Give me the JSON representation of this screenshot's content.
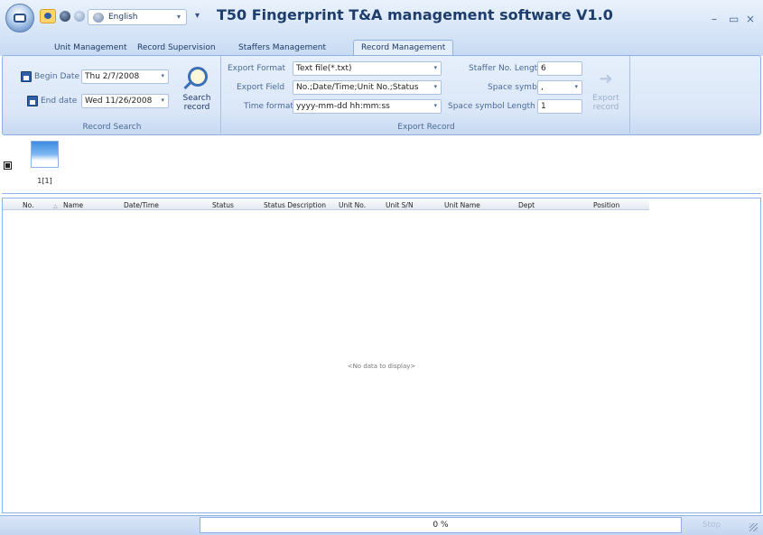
{
  "title_bar": {
    "language": "English",
    "app_title": "T50 Fingerprint T&A management software V1.0",
    "minimize": "–",
    "maximize": "▭",
    "close": "×"
  },
  "tabs": [
    "Unit Management",
    "Record Supervision",
    "Staffers Management",
    "Record Management"
  ],
  "active_tab": "Record Management",
  "record_search": {
    "begin_label": "Begin Date",
    "begin_value": "Thu 2/7/2008",
    "end_label": "End date",
    "end_value": "Wed 11/26/2008",
    "search_button": "Search record",
    "group_label": "Record Search"
  },
  "export_record": {
    "format_label": "Export Format",
    "format_value": "Text file(*.txt)",
    "field_label": "Export Field",
    "field_value": "No.;Date/Time;Unit No.;Status",
    "time_label": "Time format",
    "time_value": "yyyy-mm-dd hh:mm:ss",
    "staffer_len_label": "Staffer No. Length",
    "staffer_len_value": "6",
    "space_symbol_label": "Space symbol",
    "space_symbol_value": ",",
    "space_len_label": "Space symbol Length",
    "space_len_value": "1",
    "export_button": "Export record",
    "group_label": "Export Record"
  },
  "unit": {
    "label": "1[1]",
    "checked": true
  },
  "grid": {
    "columns": [
      "No.",
      "Name",
      "Date/Time",
      "Status",
      "Status Description",
      "Unit No.",
      "Unit S/N",
      "Unit Name",
      "Dept",
      "Position"
    ],
    "empty_text": "<No data to display>"
  },
  "status_bar": {
    "progress_text": "0 %",
    "stop_label": "Stop"
  }
}
